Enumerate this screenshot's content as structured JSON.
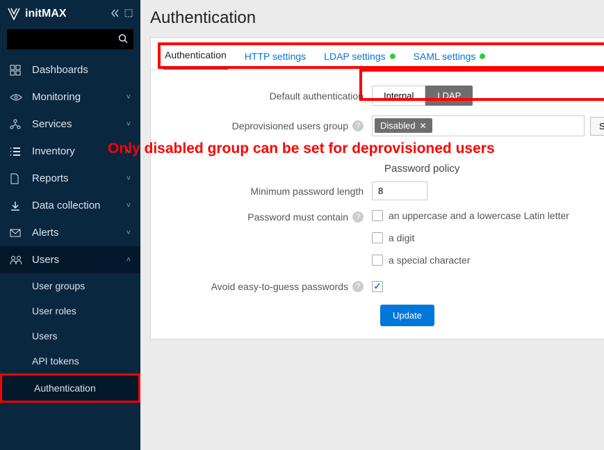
{
  "brand": "initMAX",
  "search_placeholder": "",
  "sidebar": [
    {
      "icon": "dashboards",
      "label": "Dashboards",
      "caret": ""
    },
    {
      "icon": "monitoring",
      "label": "Monitoring",
      "caret": "˅"
    },
    {
      "icon": "services",
      "label": "Services",
      "caret": "˅"
    },
    {
      "icon": "inventory",
      "label": "Inventory",
      "caret": "˅"
    },
    {
      "icon": "reports",
      "label": "Reports",
      "caret": "˅"
    },
    {
      "icon": "data",
      "label": "Data collection",
      "caret": "˅"
    },
    {
      "icon": "alerts",
      "label": "Alerts",
      "caret": "˅"
    },
    {
      "icon": "users",
      "label": "Users",
      "caret": "˄"
    }
  ],
  "users_sub": [
    {
      "label": "User groups"
    },
    {
      "label": "User roles"
    },
    {
      "label": "Users"
    },
    {
      "label": "API tokens"
    },
    {
      "label": "Authentication"
    }
  ],
  "page_title": "Authentication",
  "tabs": [
    {
      "label": "Authentication",
      "active": true,
      "dot": false
    },
    {
      "label": "HTTP settings",
      "active": false,
      "dot": false
    },
    {
      "label": "LDAP settings",
      "active": false,
      "dot": true
    },
    {
      "label": "SAML settings",
      "active": false,
      "dot": true
    }
  ],
  "form": {
    "default_auth_label": "Default authentication",
    "auth_internal": "Internal",
    "auth_ldap": "LDAP",
    "deprov_label": "Deprovisioned users group",
    "deprov_tag": "Disabled",
    "select_btn": "Select",
    "annotation": "Only disabled group can be set for deprovisioned users",
    "pw_policy_head": "Password policy",
    "min_len_label": "Minimum password length",
    "min_len_value": "8",
    "must_contain_label": "Password must contain",
    "opt1": "an uppercase and a lowercase Latin letter",
    "opt2": "a digit",
    "opt3": "a special character",
    "avoid_label": "Avoid easy-to-guess passwords",
    "update_btn": "Update"
  }
}
